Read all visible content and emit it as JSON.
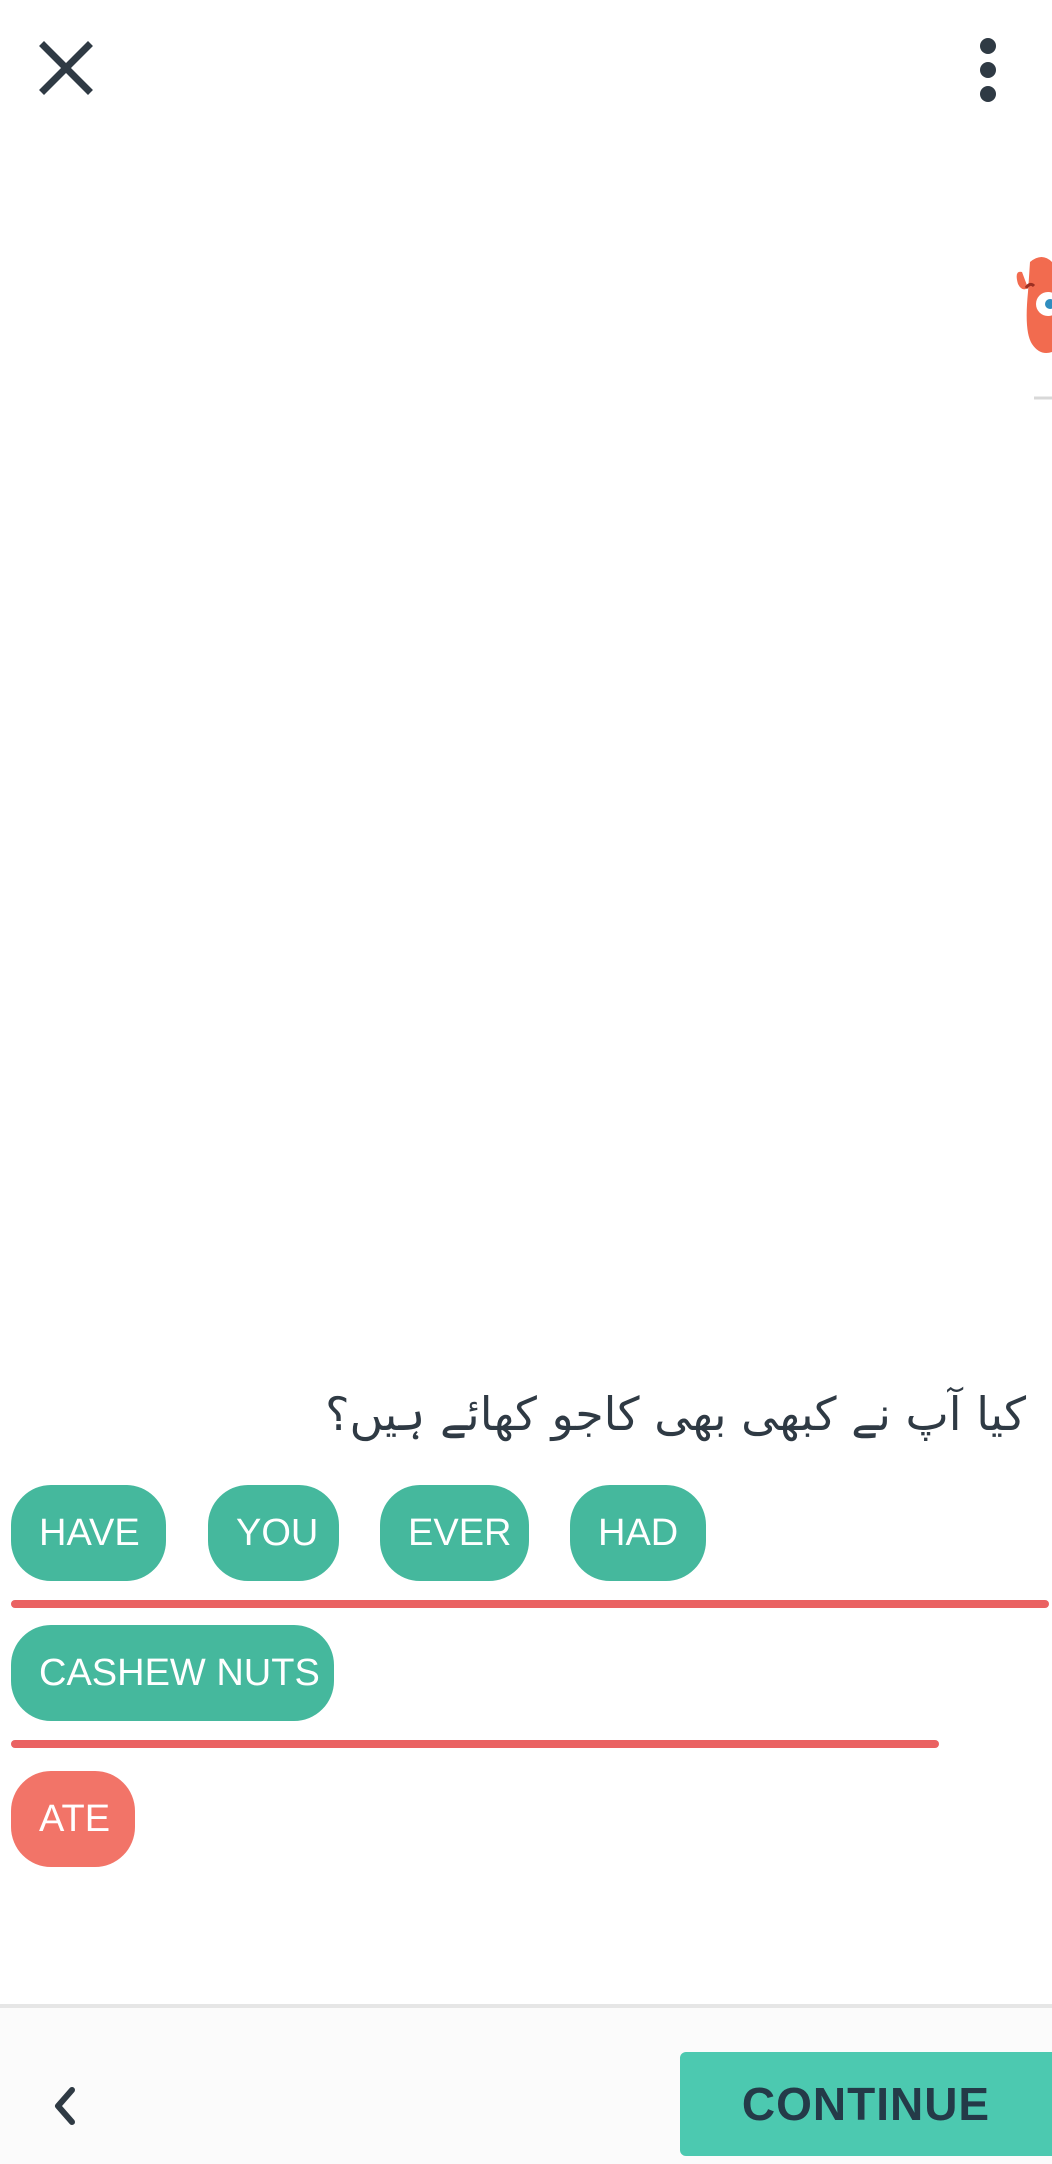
{
  "top_bar": {
    "close_icon": "close-icon",
    "more_icon": "more-vertical-icon"
  },
  "prompt": {
    "text": "کیا آپ نے کبھی بھی کاجو کھائے ہیں؟"
  },
  "answer_rows": [
    {
      "chips": [
        "HAVE",
        "YOU",
        "EVER",
        "HAD"
      ]
    },
    {
      "chips": [
        "CASHEW NUTS"
      ]
    }
  ],
  "word_bank": {
    "chips": [
      "ATE"
    ]
  },
  "colors": {
    "chip_teal": "#45b89d",
    "chip_coral": "#f27468",
    "line_red": "#ea6262",
    "continue_bg": "#4cc9b0"
  },
  "bottom_bar": {
    "back_icon": "chevron-left-icon",
    "continue_label": "CONTINUE"
  }
}
